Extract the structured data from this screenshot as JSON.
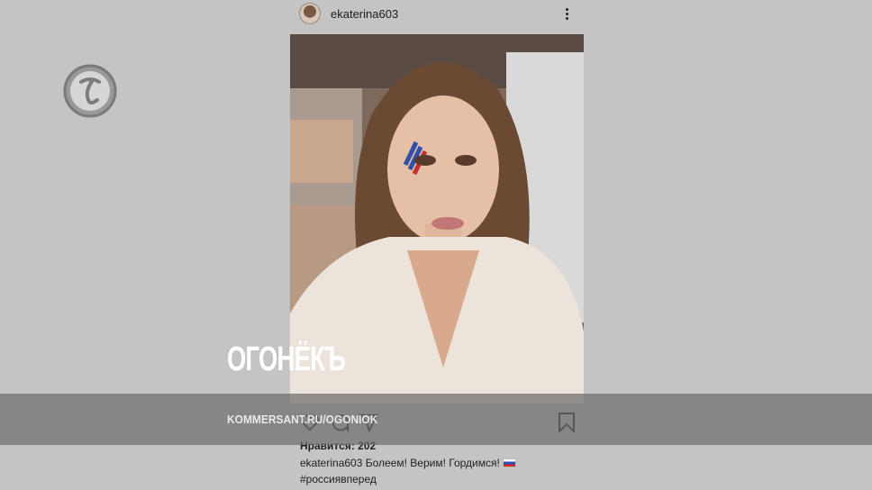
{
  "post": {
    "username": "ekaterina603",
    "more_icon": "more-vertical-icon",
    "image_alt": "selfie in car",
    "likes_label": "Нравится: 202",
    "caption_user": "ekaterina603",
    "caption_text": " Болеем! Верим! Гордимся!",
    "caption_emoji": "russian-flag",
    "hashtag": "#россиявперед",
    "icons": [
      "heart-icon",
      "comment-icon",
      "share-icon",
      "bookmark-icon"
    ]
  },
  "brand": {
    "title": "ОГОНЁКЪ",
    "url": "KOMMERSANT.RU/OGONIOK",
    "logo": "kommersant-logo"
  },
  "colors": {
    "background": "#c4c4c4",
    "band": "#6e6e6e",
    "text": "#1e1e1e"
  }
}
